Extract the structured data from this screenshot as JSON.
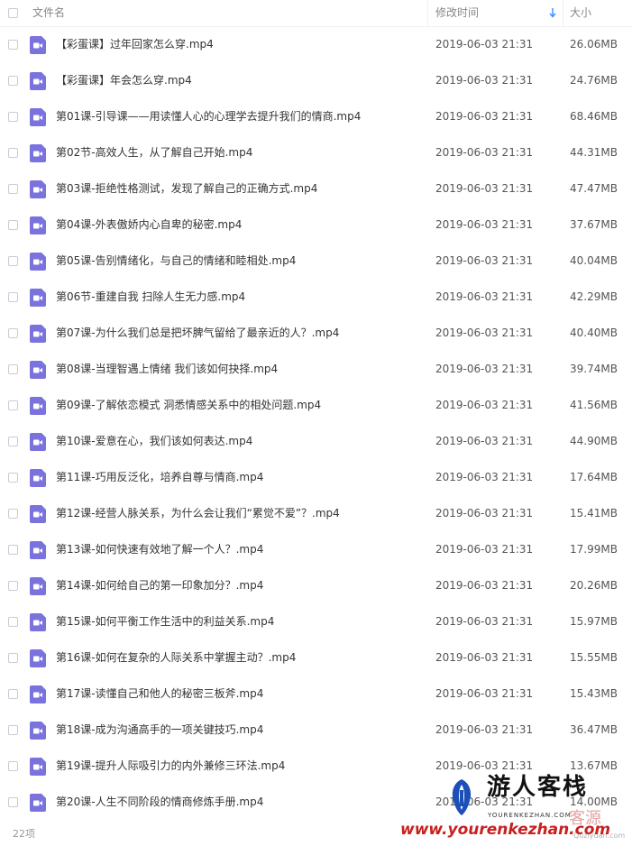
{
  "header": {
    "name_label": "文件名",
    "time_label": "修改时间",
    "size_label": "大小"
  },
  "files": [
    {
      "name": "【彩蛋课】过年回家怎么穿.mp4",
      "time": "2019-06-03 21:31",
      "size": "26.06MB"
    },
    {
      "name": "【彩蛋课】年会怎么穿.mp4",
      "time": "2019-06-03 21:31",
      "size": "24.76MB"
    },
    {
      "name": "第01课-引导课——用读懂人心的心理学去提升我们的情商.mp4",
      "time": "2019-06-03 21:31",
      "size": "68.46MB"
    },
    {
      "name": "第02节-高效人生，从了解自己开始.mp4",
      "time": "2019-06-03 21:31",
      "size": "44.31MB"
    },
    {
      "name": "第03课-拒绝性格测试，发现了解自己的正确方式.mp4",
      "time": "2019-06-03 21:31",
      "size": "47.47MB"
    },
    {
      "name": "第04课-外表傲娇内心自卑的秘密.mp4",
      "time": "2019-06-03 21:31",
      "size": "37.67MB"
    },
    {
      "name": "第05课-告别情绪化，与自己的情绪和睦相处.mp4",
      "time": "2019-06-03 21:31",
      "size": "40.04MB"
    },
    {
      "name": "第06节-重建自我 扫除人生无力感.mp4",
      "time": "2019-06-03 21:31",
      "size": "42.29MB"
    },
    {
      "name": "第07课-为什么我们总是把坏脾气留给了最亲近的人？.mp4",
      "time": "2019-06-03 21:31",
      "size": "40.40MB"
    },
    {
      "name": "第08课-当理智遇上情绪 我们该如何抉择.mp4",
      "time": "2019-06-03 21:31",
      "size": "39.74MB"
    },
    {
      "name": "第09课-了解依恋模式 洞悉情感关系中的相处问题.mp4",
      "time": "2019-06-03 21:31",
      "size": "41.56MB"
    },
    {
      "name": "第10课-爱意在心，我们该如何表达.mp4",
      "time": "2019-06-03 21:31",
      "size": "44.90MB"
    },
    {
      "name": "第11课-巧用反泛化，培养自尊与情商.mp4",
      "time": "2019-06-03 21:31",
      "size": "17.64MB"
    },
    {
      "name": "第12课-经营人脉关系，为什么会让我们“累觉不爱”？.mp4",
      "time": "2019-06-03 21:31",
      "size": "15.41MB"
    },
    {
      "name": "第13课-如何快速有效地了解一个人？.mp4",
      "time": "2019-06-03 21:31",
      "size": "17.99MB"
    },
    {
      "name": "第14课-如何给自己的第一印象加分？.mp4",
      "time": "2019-06-03 21:31",
      "size": "20.26MB"
    },
    {
      "name": "第15课-如何平衡工作生活中的利益关系.mp4",
      "time": "2019-06-03 21:31",
      "size": "15.97MB"
    },
    {
      "name": "第16课-如何在复杂的人际关系中掌握主动？.mp4",
      "time": "2019-06-03 21:31",
      "size": "15.55MB"
    },
    {
      "name": "第17课-读懂自己和他人的秘密三板斧.mp4",
      "time": "2019-06-03 21:31",
      "size": "15.43MB"
    },
    {
      "name": "第18课-成为沟通高手的一项关键技巧.mp4",
      "time": "2019-06-03 21:31",
      "size": "36.47MB"
    },
    {
      "name": "第19课-提升人际吸引力的内外兼修三环法.mp4",
      "time": "2019-06-03 21:31",
      "size": "13.67MB"
    },
    {
      "name": "第20课-人生不同阶段的情商修炼手册.mp4",
      "time": "2019-06-03 21:31",
      "size": "14.00MB"
    }
  ],
  "footer": {
    "count": "22项"
  },
  "watermark": {
    "title": "游人客栈",
    "subtitle": "YOURENKEZHAN.COM",
    "url": "www.yourenkezhan.com",
    "second_text": "客源",
    "second_url": "Quziyuan.com"
  },
  "colors": {
    "file_icon": "#7b73dd",
    "sort_arrow": "#3b8cff",
    "watermark_url": "#c81f1f"
  },
  "icons": {
    "sort": "arrow-down-icon",
    "file": "video-file-icon",
    "logo": "watermark-logo-icon"
  }
}
